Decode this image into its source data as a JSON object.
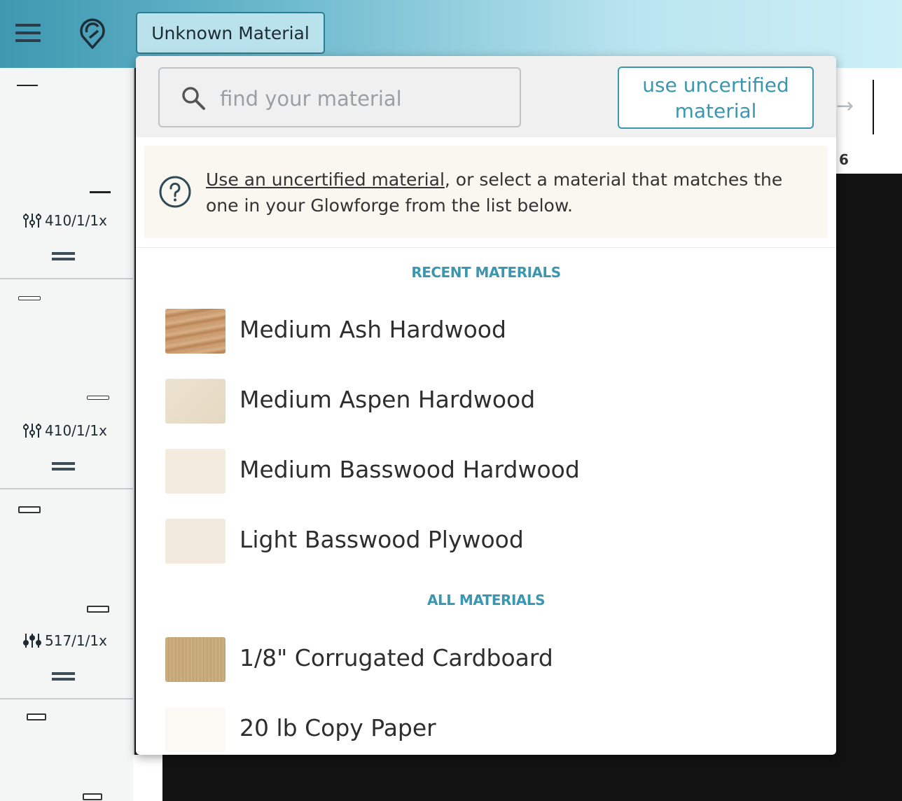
{
  "header": {
    "menu_icon": "hamburger-icon",
    "logo_icon": "glowforge-logo-icon",
    "material_button_label": "Unknown Material"
  },
  "left_panel": {
    "steps": [
      {
        "settings": "410/1/1x"
      },
      {
        "settings": "410/1/1x"
      },
      {
        "settings": "517/1/1x"
      }
    ]
  },
  "ruler": {
    "label": "6"
  },
  "dropdown": {
    "search_placeholder": "find your material",
    "search_value": "",
    "uncertified_button_label": "use uncertified material",
    "info": {
      "link_text": "Use an uncertified material",
      "rest_text": ", or select a material that matches the one in your Glowforge from the list below."
    },
    "recent_title": "RECENT MATERIALS",
    "recent_materials": [
      {
        "name": "Medium Ash Hardwood"
      },
      {
        "name": "Medium Aspen Hardwood"
      },
      {
        "name": "Medium Basswood Hardwood"
      },
      {
        "name": "Light Basswood Plywood"
      }
    ],
    "all_title": "ALL MATERIALS",
    "all_materials": [
      {
        "name": "1/8\" Corrugated Cardboard"
      },
      {
        "name": "20 lb Copy Paper"
      }
    ]
  },
  "colors": {
    "accent": "#3b97b0",
    "info_bg": "#f9f7ef"
  }
}
